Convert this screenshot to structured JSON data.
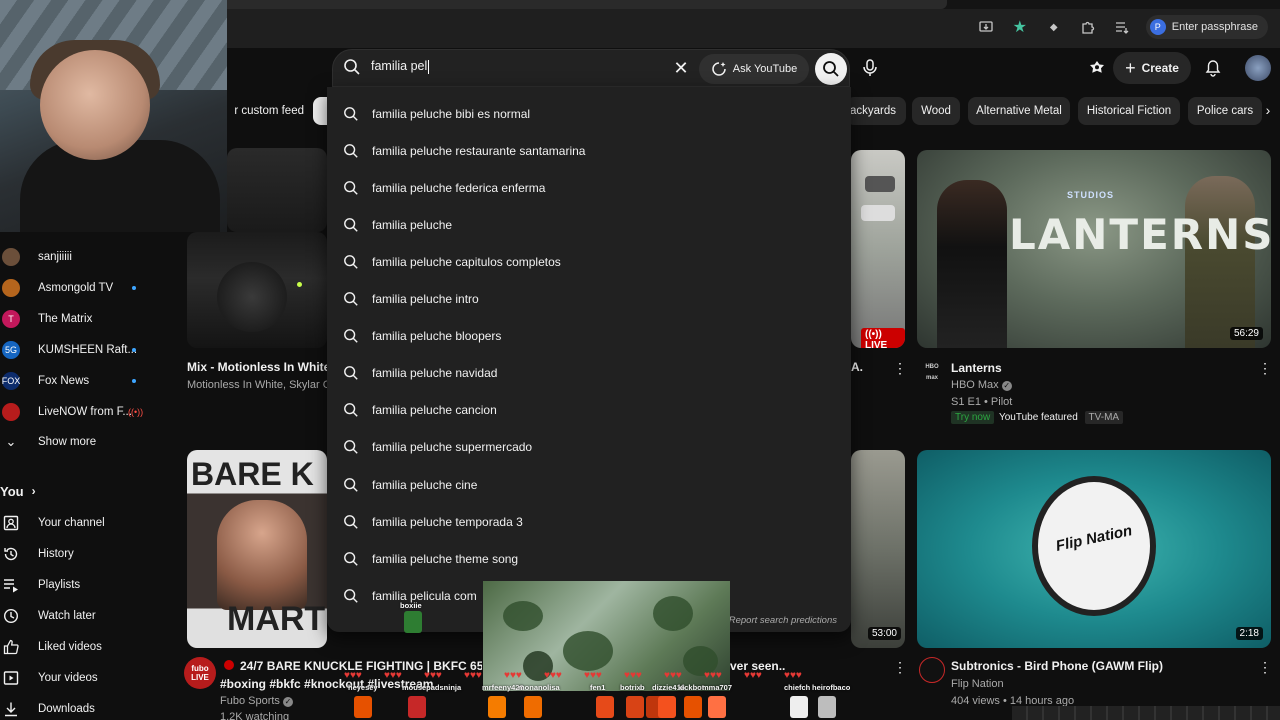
{
  "browser": {
    "profile_label": "Enter passphrase",
    "profile_initial": "P"
  },
  "header": {
    "create_label": "Create",
    "chips": [
      "r custom feed",
      "ackyards",
      "Wood",
      "Alternative Metal",
      "Historical Fiction",
      "Police cars"
    ]
  },
  "search": {
    "query": "familia pel",
    "ask_label": "Ask YouTube",
    "suggestions": [
      "familia peluche bibi es normal",
      "familia peluche restaurante santamarina",
      "familia peluche federica enferma",
      "familia peluche",
      "familia peluche capitulos completos",
      "familia peluche intro",
      "familia peluche bloopers",
      "familia peluche navidad",
      "familia peluche cancion",
      "familia peluche supermercado",
      "familia peluche cine",
      "familia peluche temporada 3",
      "familia peluche theme song",
      "familia pelicula com"
    ],
    "report_label": "Report search predictions"
  },
  "sidebar": {
    "subscriptions": [
      {
        "name": "sanjiiiii",
        "avatar": "",
        "color": "#6b4f3a",
        "badge": ""
      },
      {
        "name": "Asmongold TV",
        "avatar": "",
        "color": "#b5651d",
        "badge": "dot"
      },
      {
        "name": "The Matrix",
        "avatar": "T",
        "color": "#c2185b",
        "badge": ""
      },
      {
        "name": "KUMSHEEN Raft...",
        "avatar": "5G",
        "color": "#1565c0",
        "badge": "dot"
      },
      {
        "name": "Fox News",
        "avatar": "FOX",
        "color": "#0d2c6c",
        "badge": "dot"
      },
      {
        "name": "LiveNOW from F...",
        "avatar": "",
        "color": "#b71c1c",
        "badge": "live"
      }
    ],
    "show_more": "Show more",
    "you_label": "You",
    "you_items": [
      {
        "label": "Your channel",
        "icon": "person-box-icon"
      },
      {
        "label": "History",
        "icon": "history-icon"
      },
      {
        "label": "Playlists",
        "icon": "playlist-icon"
      },
      {
        "label": "Watch later",
        "icon": "clock-icon"
      },
      {
        "label": "Liked videos",
        "icon": "thumbs-up-icon"
      },
      {
        "label": "Your videos",
        "icon": "play-box-icon"
      },
      {
        "label": "Downloads",
        "icon": "download-icon"
      }
    ]
  },
  "videos": {
    "mix": {
      "title": "Mix - Motionless In White",
      "meta": "Motionless In White, Skylar G"
    },
    "live_card": {
      "badge": "LIVE"
    },
    "lanterns": {
      "title": "Lanterns",
      "channel": "HBO Max",
      "meta": "S1 E1 • Pilot",
      "try_now": "Try now",
      "featured": "YouTube featured",
      "rating": "TV-MA",
      "duration": "56:29",
      "thumb_text": "LANTERNS",
      "studio_text": "STUDIOS",
      "hbo": "HBO max"
    },
    "bkfc": {
      "title": "24/7 BARE KNUCKLE FIGHTING | BKFC 65 -",
      "tags": "#boxing #bkfc #knockout #livestream",
      "channel": "Fubo Sports",
      "meta": "1.2K watching",
      "thumb_top": "BARE K",
      "thumb_bottom": "MART",
      "fubo": "fubo",
      "fubo_live": "LIVE"
    },
    "middle": {
      "title": "ver seen..",
      "duration": "53:00",
      "dot": "A."
    },
    "subtronics": {
      "title": "Subtronics - Bird Phone (GAWM Flip)",
      "channel": "Flip Nation",
      "meta": "404 views • 14 hours ago",
      "duration": "2:18",
      "logo_text": "Flip Nation"
    }
  },
  "overlay": {
    "streamer": "boxiie",
    "chatters": [
      "heyesey",
      "mousepadsninja",
      "mrfeeny420",
      "monanolisa",
      "fen1",
      "botrix",
      "b",
      "dizzie416",
      "kickbot",
      "mma707",
      "chiefch",
      "heirofbaco"
    ]
  },
  "colors": {
    "bg": "#0f0f0f",
    "surface": "#212121",
    "chip": "#272727",
    "accent_live": "#cc0000",
    "link_blue": "#3ea6ff",
    "try_green": "#2ba640"
  }
}
